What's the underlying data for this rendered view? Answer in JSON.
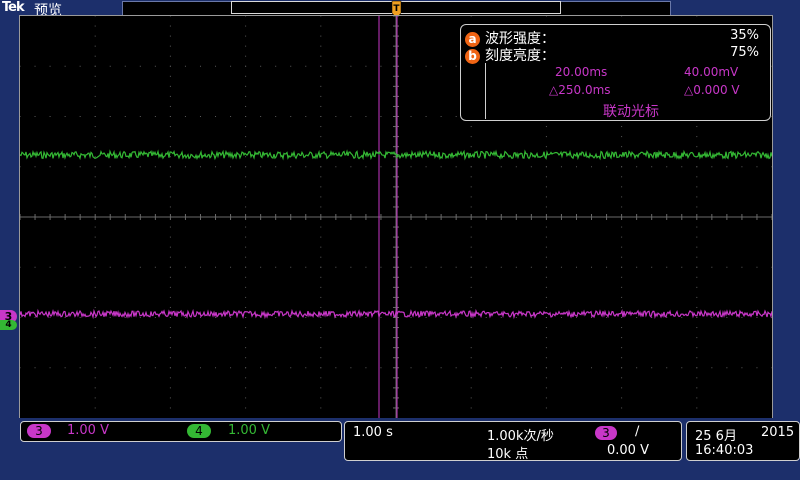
{
  "header": {
    "brand": "Tek",
    "mode": "预览"
  },
  "channels": [
    {
      "id": "3",
      "color": "#c837c8",
      "scale": "1.00 V"
    },
    {
      "id": "4",
      "color": "#34b834",
      "scale": "1.00 V"
    }
  ],
  "overlay": {
    "waveform_intensity": {
      "badge": "a",
      "label": "波形强度：",
      "value": "35%"
    },
    "graticule_intensity": {
      "badge": "b",
      "label": "刻度亮度：",
      "value": "75%"
    },
    "cursor": {
      "time": "20.00ms",
      "voltage": "40.00mV",
      "delta_time": "△250.0ms",
      "delta_voltage": "△0.000 V",
      "link_label": "联动光标"
    }
  },
  "acquisition": {
    "timebase": "1.00 s",
    "sample_rate": "1.00k次/秒",
    "record_length": "10k 点",
    "trigger_source": "3",
    "trigger_slope": "∕",
    "trigger_level": "0.00 V"
  },
  "datetime": {
    "date": "25 6月",
    "year": "2015",
    "time": "16:40:03"
  },
  "colors": {
    "ch3": "#c837c8",
    "ch4": "#34b834",
    "overlay_badge": "#f06414",
    "background": "#1c2f6b"
  }
}
